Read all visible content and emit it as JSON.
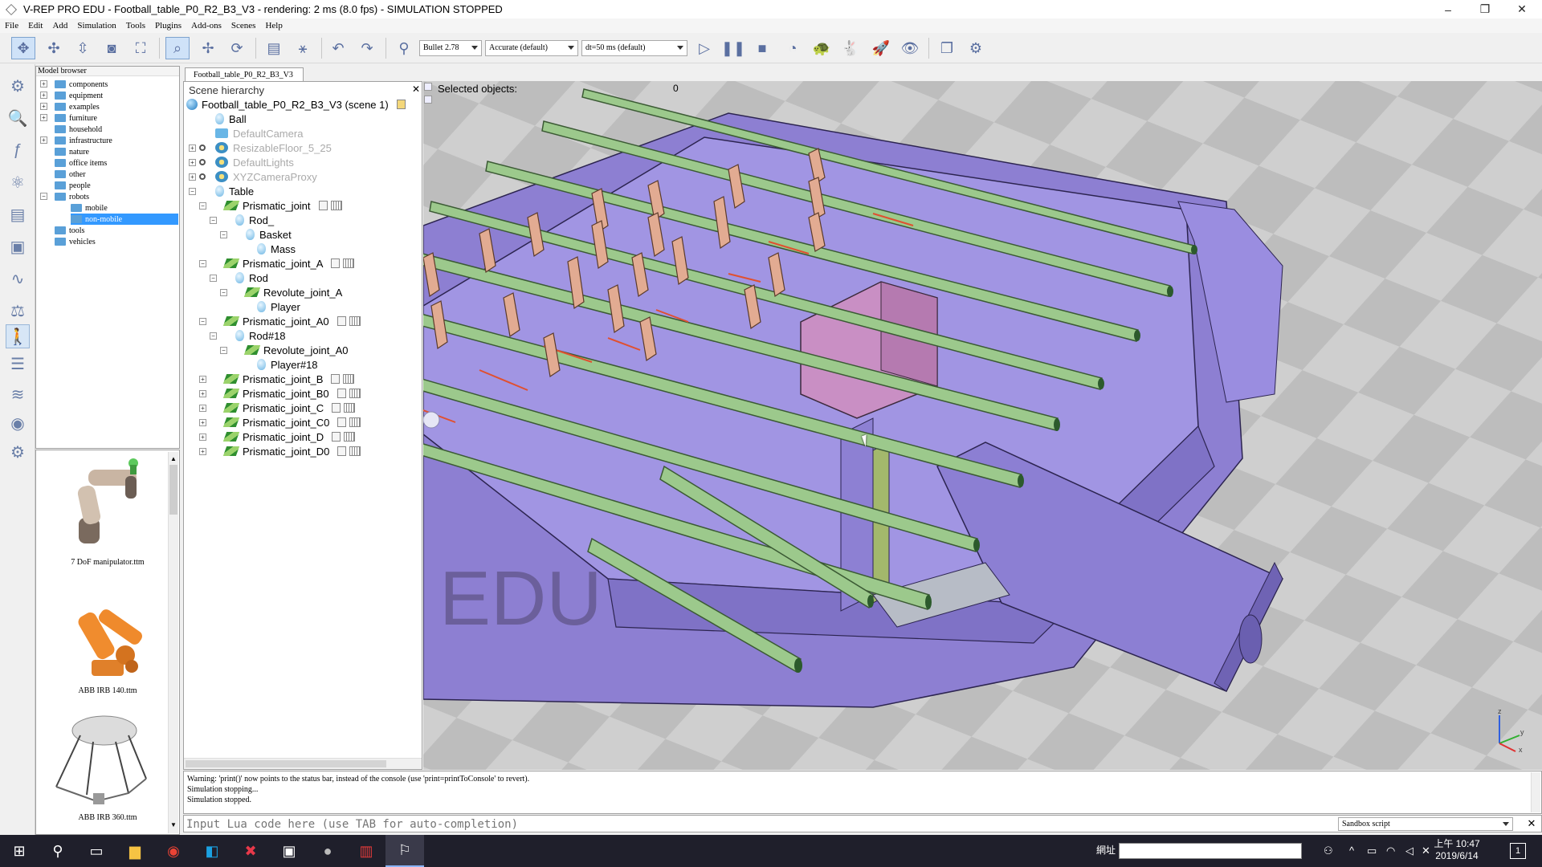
{
  "window": {
    "title": "V-REP PRO EDU - Football_table_P0_R2_B3_V3 - rendering: 2 ms (8.0 fps) - SIMULATION STOPPED",
    "minimize": "–",
    "maximize": "❐",
    "close": "✕"
  },
  "menu": [
    "File",
    "Edit",
    "Add",
    "Simulation",
    "Tools",
    "Plugins",
    "Add-ons",
    "Scenes",
    "Help"
  ],
  "toolbar": {
    "engine": "Bullet 2.78",
    "accuracy": "Accurate (default)",
    "timestep": "dt=50 ms (default)"
  },
  "model_browser": {
    "title": "Model browser",
    "folders": [
      "components",
      "equipment",
      "examples",
      "furniture",
      "household",
      "infrastructure",
      "nature",
      "office items",
      "other",
      "people",
      "robots",
      "mobile",
      "non-mobile",
      "tools",
      "vehicles"
    ],
    "thumbnails": [
      "7 DoF manipulator.ttm",
      "ABB IRB 140.ttm",
      "ABB IRB 360.ttm"
    ]
  },
  "scene_tab": "Football_table_P0_R2_B3_V3",
  "hierarchy": {
    "title": "Scene hierarchy",
    "root": "Football_table_P0_R2_B3_V3 (scene 1)",
    "items": [
      "Ball",
      "DefaultCamera",
      "ResizableFloor_5_25",
      "DefaultLights",
      "XYZCameraProxy",
      "Table",
      "Prismatic_joint",
      "Rod_",
      "Basket",
      "Mass",
      "Prismatic_joint_A",
      "Rod",
      "Revolute_joint_A",
      "Player",
      "Prismatic_joint_A0",
      "Rod#18",
      "Revolute_joint_A0",
      "Player#18",
      "Prismatic_joint_B",
      "Prismatic_joint_B0",
      "Prismatic_joint_C",
      "Prismatic_joint_C0",
      "Prismatic_joint_D",
      "Prismatic_joint_D0"
    ]
  },
  "viewport": {
    "selected_label": "Selected objects:",
    "selected_count": "0",
    "watermark": "EDU",
    "axes": {
      "x": "x",
      "y": "y",
      "z": "z"
    }
  },
  "console": {
    "lines": [
      "Warning: 'print()' now points to the status bar, instead of the console (use 'print=printToConsole' to revert).",
      "Simulation stopping...",
      "Simulation stopped."
    ]
  },
  "lua": {
    "placeholder": "Input Lua code here (use TAB for auto-completion)",
    "script_type": "Sandbox script",
    "close": "✕"
  },
  "taskbar": {
    "address_label": "網址",
    "time": "上午 10:47",
    "date": "2019/6/14",
    "notifications": "1"
  },
  "colors": {
    "table": "#9183d6",
    "rods": "#9cc98c",
    "players": "#e2ab92",
    "goal": "#c98fc4",
    "floor_light": "#d0d0d0",
    "floor_dark": "#a9a9a9"
  }
}
